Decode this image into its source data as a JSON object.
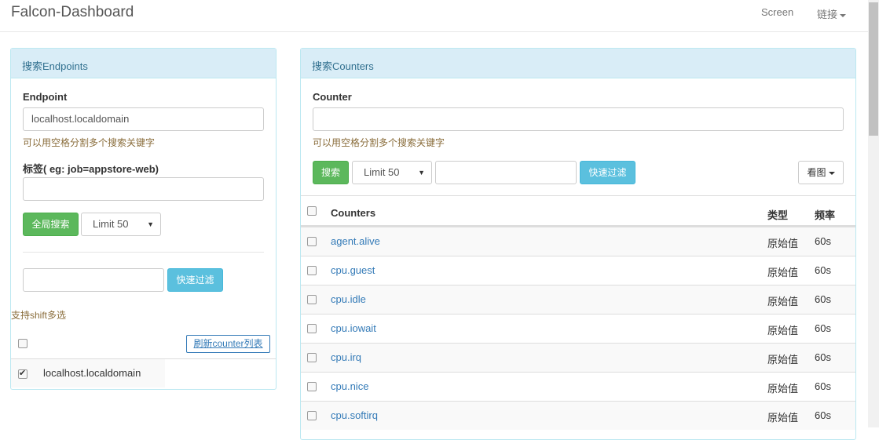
{
  "navbar": {
    "brand": "Falcon-Dashboard",
    "screen_link": "Screen",
    "links_dropdown": "链接"
  },
  "endpoints_panel": {
    "heading": "搜索Endpoints",
    "endpoint_label": "Endpoint",
    "endpoint_value": "localhost.localdomain",
    "endpoint_help": "可以用空格分割多个搜索关键字",
    "tag_label": "标签( eg: job=appstore-web)",
    "tag_value": "",
    "global_search_button": "全局搜索",
    "limit_select": "Limit 50",
    "filter_value": "",
    "quick_filter_button": "快速过滤",
    "shift_hint": "支持shift多选",
    "refresh_counters_button": "刷新counter列表",
    "endpoints": [
      {
        "name": "localhost.localdomain",
        "checked": true
      }
    ]
  },
  "counters_panel": {
    "heading": "搜索Counters",
    "counter_label": "Counter",
    "counter_value": "",
    "counter_help": "可以用空格分割多个搜索关键字",
    "search_button": "搜索",
    "limit_select": "Limit 50",
    "filter_value": "",
    "quick_filter_button": "快速过滤",
    "view_chart_button": "看图",
    "table": {
      "headers": {
        "counters": "Counters",
        "type": "类型",
        "freq": "频率"
      },
      "rows": [
        {
          "counter": "agent.alive",
          "type": "原始值",
          "freq": "60s"
        },
        {
          "counter": "cpu.guest",
          "type": "原始值",
          "freq": "60s"
        },
        {
          "counter": "cpu.idle",
          "type": "原始值",
          "freq": "60s"
        },
        {
          "counter": "cpu.iowait",
          "type": "原始值",
          "freq": "60s"
        },
        {
          "counter": "cpu.irq",
          "type": "原始值",
          "freq": "60s"
        },
        {
          "counter": "cpu.nice",
          "type": "原始值",
          "freq": "60s"
        },
        {
          "counter": "cpu.softirq",
          "type": "原始值",
          "freq": "60s"
        }
      ]
    }
  },
  "colors": {
    "panel_heading_bg": "#d9edf7",
    "panel_border": "#bce8f1",
    "success": "#5cb85c",
    "info": "#5bc0de",
    "link": "#337ab7",
    "help_text": "#8a6d3b"
  }
}
